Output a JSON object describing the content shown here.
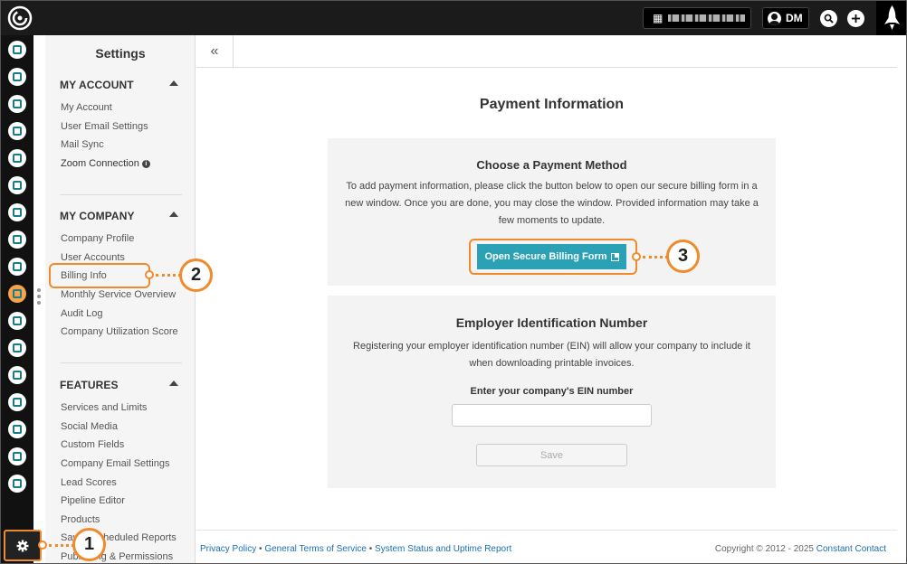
{
  "topbar": {
    "user_initials": "DM"
  },
  "rail": {
    "icons": [
      "contacts-icon",
      "email-icon",
      "tasks-icon",
      "map-icon",
      "pipeline-icon",
      "list-icon",
      "megaphone-icon",
      "forms-icon",
      "thumbs-up-icon",
      "calendar-icon",
      "schedule-icon",
      "users-icon",
      "chart-icon",
      "support-icon",
      "add-user-icon",
      "reports-icon",
      "integrations-icon"
    ]
  },
  "sidebar": {
    "title": "Settings",
    "my_account": {
      "heading": "MY ACCOUNT",
      "items": [
        "My Account",
        "User Email Settings",
        "Mail Sync",
        "Zoom Connection"
      ]
    },
    "my_company": {
      "heading": "MY COMPANY",
      "items": [
        "Company Profile",
        "User Accounts",
        "Billing Info",
        "Monthly Service Overview",
        "Audit Log",
        "Company Utilization Score"
      ]
    },
    "features": {
      "heading": "FEATURES",
      "items": [
        "Services and Limits",
        "Social Media",
        "Custom Fields",
        "Company Email Settings",
        "Lead Scores",
        "Pipeline Editor",
        "Products",
        "Saved Scheduled Reports",
        "Publishing & Permissions"
      ]
    }
  },
  "main": {
    "title": "Payment Information",
    "payment_card": {
      "title": "Choose a Payment Method",
      "description": "To add payment information, please click the button below to open our secure billing form in a new window. Once you are done, you may close the window. Provided information may take a few moments to update.",
      "button_label": "Open Secure Billing Form"
    },
    "ein_card": {
      "title": "Employer Identification Number",
      "description": "Registering your employer identification number (EIN) will allow your company to include it when downloading printable invoices.",
      "input_label": "Enter your company's EIN number",
      "input_value": "",
      "save_label": "Save"
    }
  },
  "footer": {
    "links": [
      "Privacy Policy",
      "General Terms of Service",
      "System Status and Uptime Report"
    ],
    "separator": "•",
    "copyright": "Copyright © 2012 - 2025",
    "copyright_link": "Constant Contact"
  },
  "callouts": [
    "1",
    "2",
    "3"
  ],
  "colors": {
    "accent": "#2aa1b4",
    "callout": "#f08a2a",
    "topbar": "#1b1b1b",
    "link": "#1b6fb5"
  }
}
